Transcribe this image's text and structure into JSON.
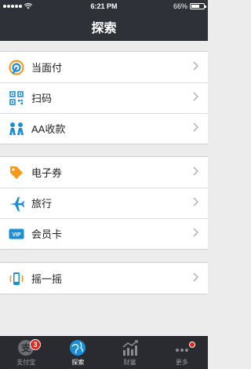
{
  "status_bar": {
    "time": "6:21 PM",
    "battery": "66%",
    "battery_level": 0.66
  },
  "nav": {
    "title": "探索"
  },
  "groups": [
    {
      "items": [
        {
          "label": "当面付",
          "icon": "pay-face-icon"
        },
        {
          "label": "扫码",
          "icon": "qr-scan-icon"
        },
        {
          "label": "AA收款",
          "icon": "aa-people-icon"
        }
      ]
    },
    {
      "items": [
        {
          "label": "电子券",
          "icon": "coupon-tag-icon"
        },
        {
          "label": "旅行",
          "icon": "plane-icon"
        },
        {
          "label": "会员卡",
          "icon": "vip-card-icon"
        }
      ]
    },
    {
      "items": [
        {
          "label": "摇一摇",
          "icon": "shake-phone-icon"
        }
      ]
    }
  ],
  "tabs": [
    {
      "label": "支付宝",
      "badge": "3"
    },
    {
      "label": "探索"
    },
    {
      "label": "财富"
    },
    {
      "label": "更多"
    }
  ],
  "colors": {
    "accent_blue": "#1a8fd6",
    "accent_orange": "#f39a1d",
    "badge_red": "#e6241b"
  }
}
